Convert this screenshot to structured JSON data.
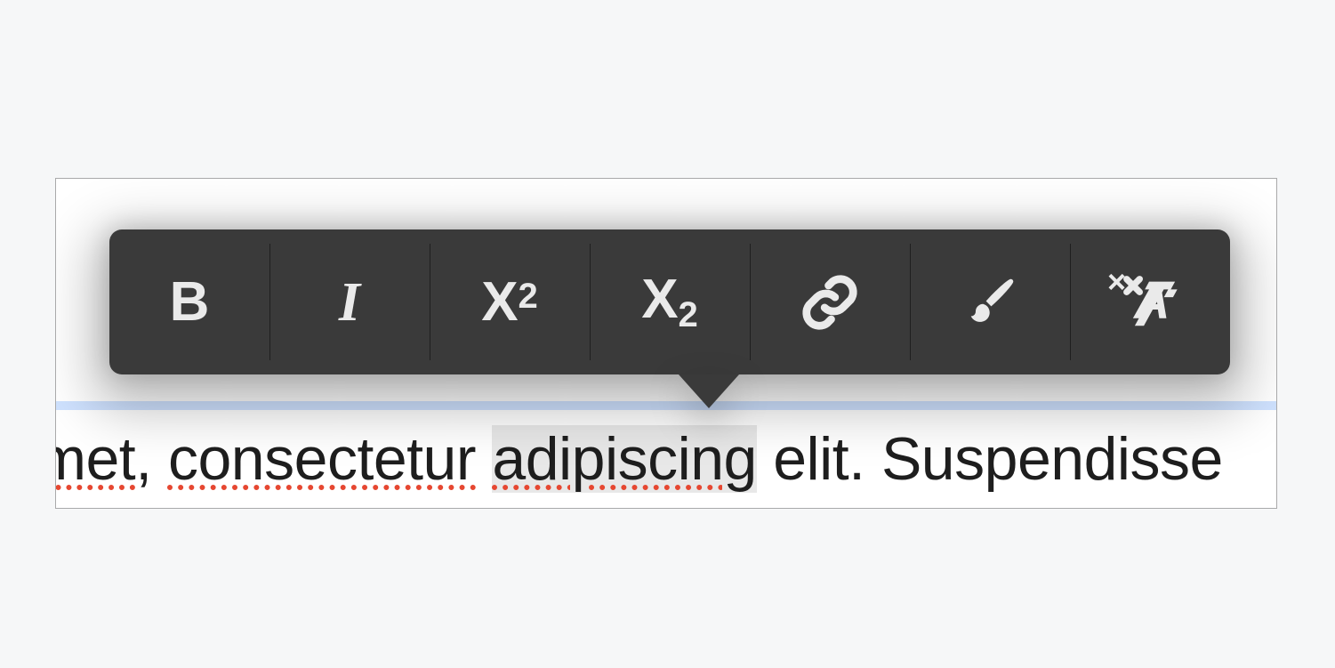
{
  "editor": {
    "text_segments": [
      {
        "text": "amet",
        "spellError": true,
        "selected": false,
        "key": "editor.text_segments.0.text"
      },
      {
        "text": ", ",
        "spellError": false,
        "selected": false,
        "key": "editor.text_segments.1.text"
      },
      {
        "text": "consectetur",
        "spellError": true,
        "selected": false,
        "key": "editor.text_segments.2.text"
      },
      {
        "text": " ",
        "spellError": false,
        "selected": false,
        "key": "editor.text_segments.3.text"
      },
      {
        "text": "adipiscing",
        "spellError": true,
        "selected": true,
        "key": "editor.text_segments.4.text"
      },
      {
        "text": " elit. Suspendisse",
        "spellError": false,
        "selected": false,
        "key": "editor.text_segments.5.text"
      }
    ]
  },
  "toolbar": {
    "buttons": [
      {
        "name": "bold",
        "label": "B",
        "kind": "text-bold"
      },
      {
        "name": "italic",
        "label": "I",
        "kind": "text-italic"
      },
      {
        "name": "superscript",
        "label": "X",
        "sup": "2",
        "kind": "text-sup"
      },
      {
        "name": "subscript",
        "label": "X",
        "sub": "2",
        "kind": "text-sub"
      },
      {
        "name": "link",
        "kind": "icon-link"
      },
      {
        "name": "highlight",
        "kind": "icon-brush"
      },
      {
        "name": "clear-format",
        "kind": "icon-clear"
      }
    ],
    "caret_under_index": 3
  },
  "colors": {
    "page_bg": "#f6f7f8",
    "editor_bg": "#ffffff",
    "editor_border": "#a9a9aa",
    "toolbar_bg": "#3a3a3a",
    "toolbar_divider": "#1f1f1f",
    "toolbar_icon": "#eaeaea",
    "block_highlight": "#cfe2ff",
    "selection_bg": "#e8e8e8",
    "spellcheck_underline": "#e64731",
    "text_color": "#1e1e1e"
  }
}
